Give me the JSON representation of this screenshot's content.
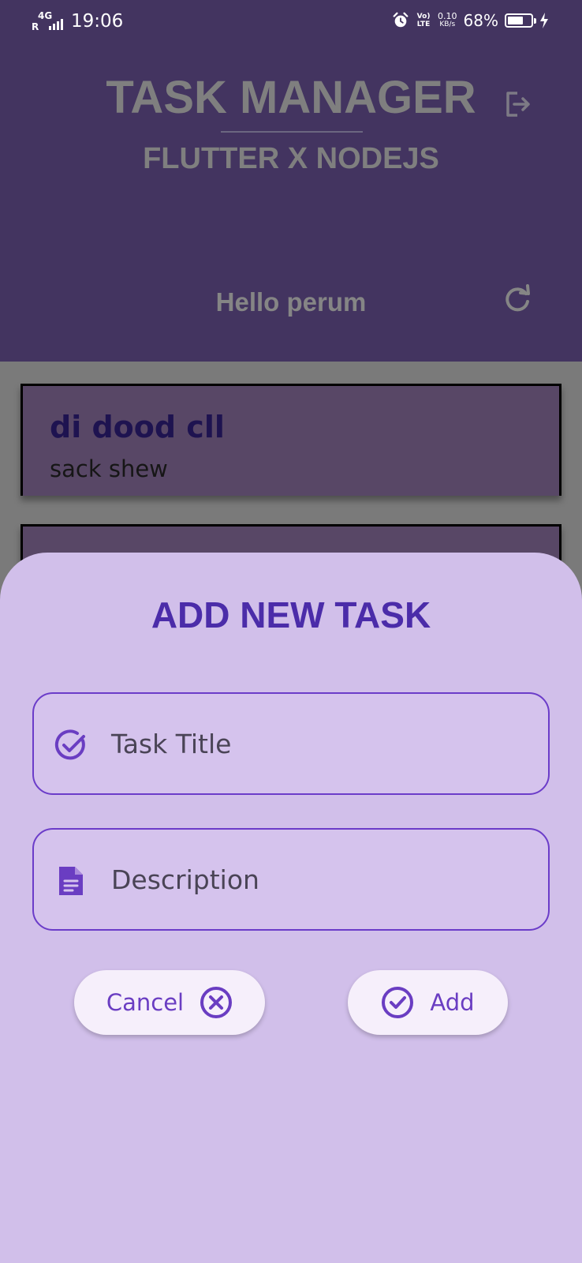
{
  "status_bar": {
    "network_prefix": "R",
    "network_type": "4G",
    "time": "19:06",
    "volte": "Vo) LTE",
    "speed_value": "0.10",
    "speed_unit": "KB/s",
    "battery": "68%",
    "battery_level": 0.68
  },
  "header": {
    "title": "TASK MANAGER",
    "subtitle": "FLUTTER X NODEJS",
    "greeting": "Hello perum"
  },
  "tasks": [
    {
      "title": "di dood cll",
      "description": "sack shew"
    },
    {
      "title": "",
      "description": ""
    }
  ],
  "sheet": {
    "title": "ADD NEW TASK",
    "title_placeholder": "Task Title",
    "description_placeholder": "Description",
    "cancel_label": "Cancel",
    "add_label": "Add"
  },
  "colors": {
    "header_bg": "#433460",
    "sheet_bg": "#d1bfea",
    "accent": "#6b3cc9",
    "title_accent": "#4b2ca9"
  }
}
